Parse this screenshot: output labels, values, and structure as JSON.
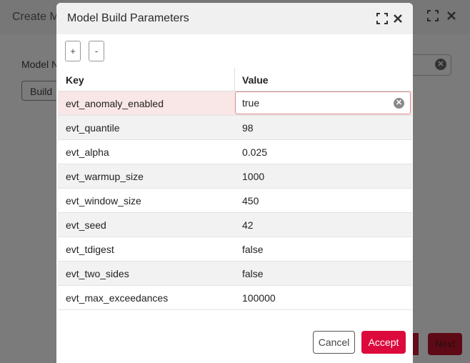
{
  "background_dialog": {
    "title": "Create M",
    "field_label": "Model N",
    "build_button_label": "Build",
    "next_button_label": "Next",
    "expand_icon": "expand-icon",
    "close_icon": "close-icon"
  },
  "modal": {
    "title": "Model Build Parameters",
    "add_label": "+",
    "remove_label": "-",
    "columns": {
      "key": "Key",
      "value": "Value"
    },
    "rows": [
      {
        "key": "evt_anomaly_enabled",
        "value": "true"
      },
      {
        "key": "evt_quantile",
        "value": "98"
      },
      {
        "key": "evt_alpha",
        "value": "0.025"
      },
      {
        "key": "evt_warmup_size",
        "value": "1000"
      },
      {
        "key": "evt_window_size",
        "value": "450"
      },
      {
        "key": "evt_seed",
        "value": "42"
      },
      {
        "key": "evt_tdigest",
        "value": "false"
      },
      {
        "key": "evt_two_sides",
        "value": "false"
      },
      {
        "key": "evt_max_exceedances",
        "value": "100000"
      }
    ],
    "selected_row": 0,
    "cancel_label": "Cancel",
    "accept_label": "Accept",
    "accent_color": "#dc0a3c"
  }
}
